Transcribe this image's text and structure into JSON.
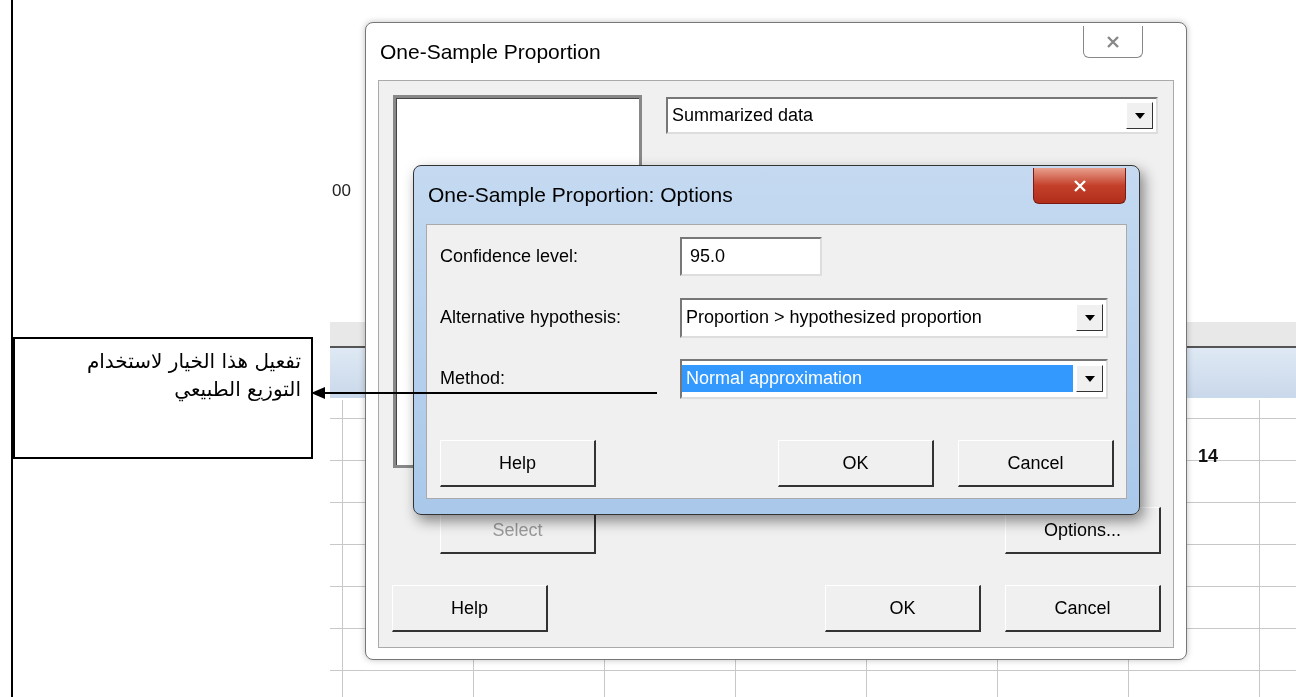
{
  "background": {
    "fragment": "00",
    "column_label": "14"
  },
  "main_dialog": {
    "title": "One-Sample Proportion",
    "active": false,
    "source_dropdown": {
      "value": "Summarized data"
    },
    "select_button": {
      "label": "Select",
      "disabled": true
    },
    "options_button": {
      "label": "Options...",
      "disabled": false
    },
    "buttons": [
      {
        "label": "Help"
      },
      {
        "label": "OK"
      },
      {
        "label": "Cancel"
      }
    ]
  },
  "options_dialog": {
    "title": "One-Sample Proportion: Options",
    "active": true,
    "fields": [
      {
        "kind": "input",
        "label": "Confidence level:",
        "value": "95.0"
      },
      {
        "kind": "dropdown",
        "label": "Alternative hypothesis:",
        "value": "Proportion > hypothesized proportion",
        "selected": false
      },
      {
        "kind": "dropdown",
        "label": "Method:",
        "value": "Normal approximation",
        "selected": true
      }
    ],
    "buttons": [
      {
        "label": "Help"
      },
      {
        "label": "OK"
      },
      {
        "label": "Cancel"
      }
    ]
  },
  "annotation": {
    "text": "تفعيل هذا الخيار لاستخدام التوزيع الطبيعي"
  }
}
